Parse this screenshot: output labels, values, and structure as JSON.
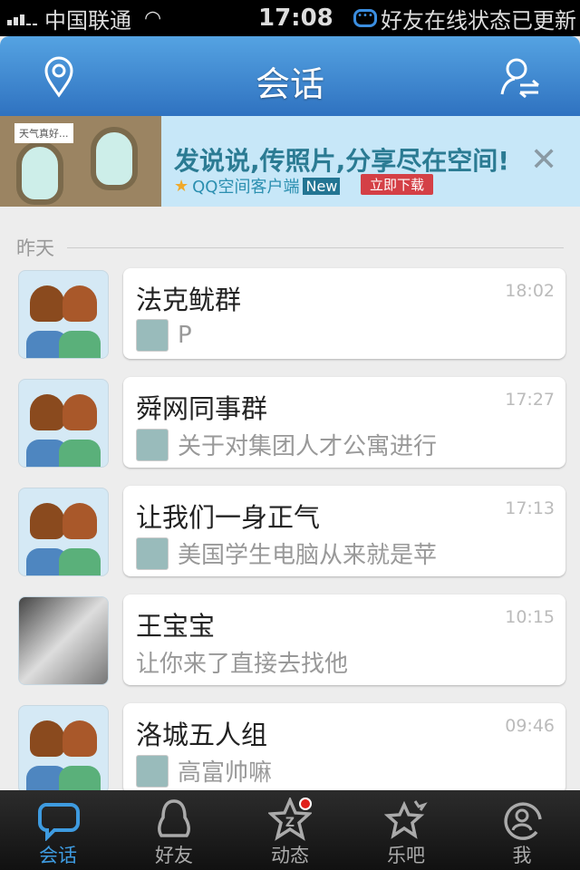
{
  "status_bar": {
    "carrier": "中国联通",
    "time": "17:08",
    "notice": "好友在线状态已更新"
  },
  "header": {
    "title": "会话"
  },
  "banner": {
    "speech": "天气真好...",
    "headline": "发说说,传照片,分享尽在空间!",
    "app_name": "QQ空间客户端",
    "new_badge": "New",
    "download_label": "立即下载"
  },
  "section_label": "昨天",
  "conversations": [
    {
      "name": "法克鱿群",
      "time": "18:02",
      "message": "P",
      "avatar": "group"
    },
    {
      "name": "舜网同事群",
      "time": "17:27",
      "message": "关于对集团人才公寓进行",
      "avatar": "group"
    },
    {
      "name": "让我们一身正气",
      "time": "17:13",
      "message": "美国学生电脑从来就是苹",
      "avatar": "group"
    },
    {
      "name": "王宝宝",
      "time": "10:15",
      "message": "让你来了直接去找他",
      "avatar": "photo"
    },
    {
      "name": "洛城五人组",
      "time": "09:46",
      "message": "高富帅嘛",
      "avatar": "group"
    }
  ],
  "tabs": [
    {
      "label": "会话",
      "active": true
    },
    {
      "label": "好友"
    },
    {
      "label": "动态",
      "badge": true
    },
    {
      "label": "乐吧"
    },
    {
      "label": "我"
    }
  ],
  "colors": {
    "accent": "#3e9be0",
    "header": "#3a87d0"
  }
}
